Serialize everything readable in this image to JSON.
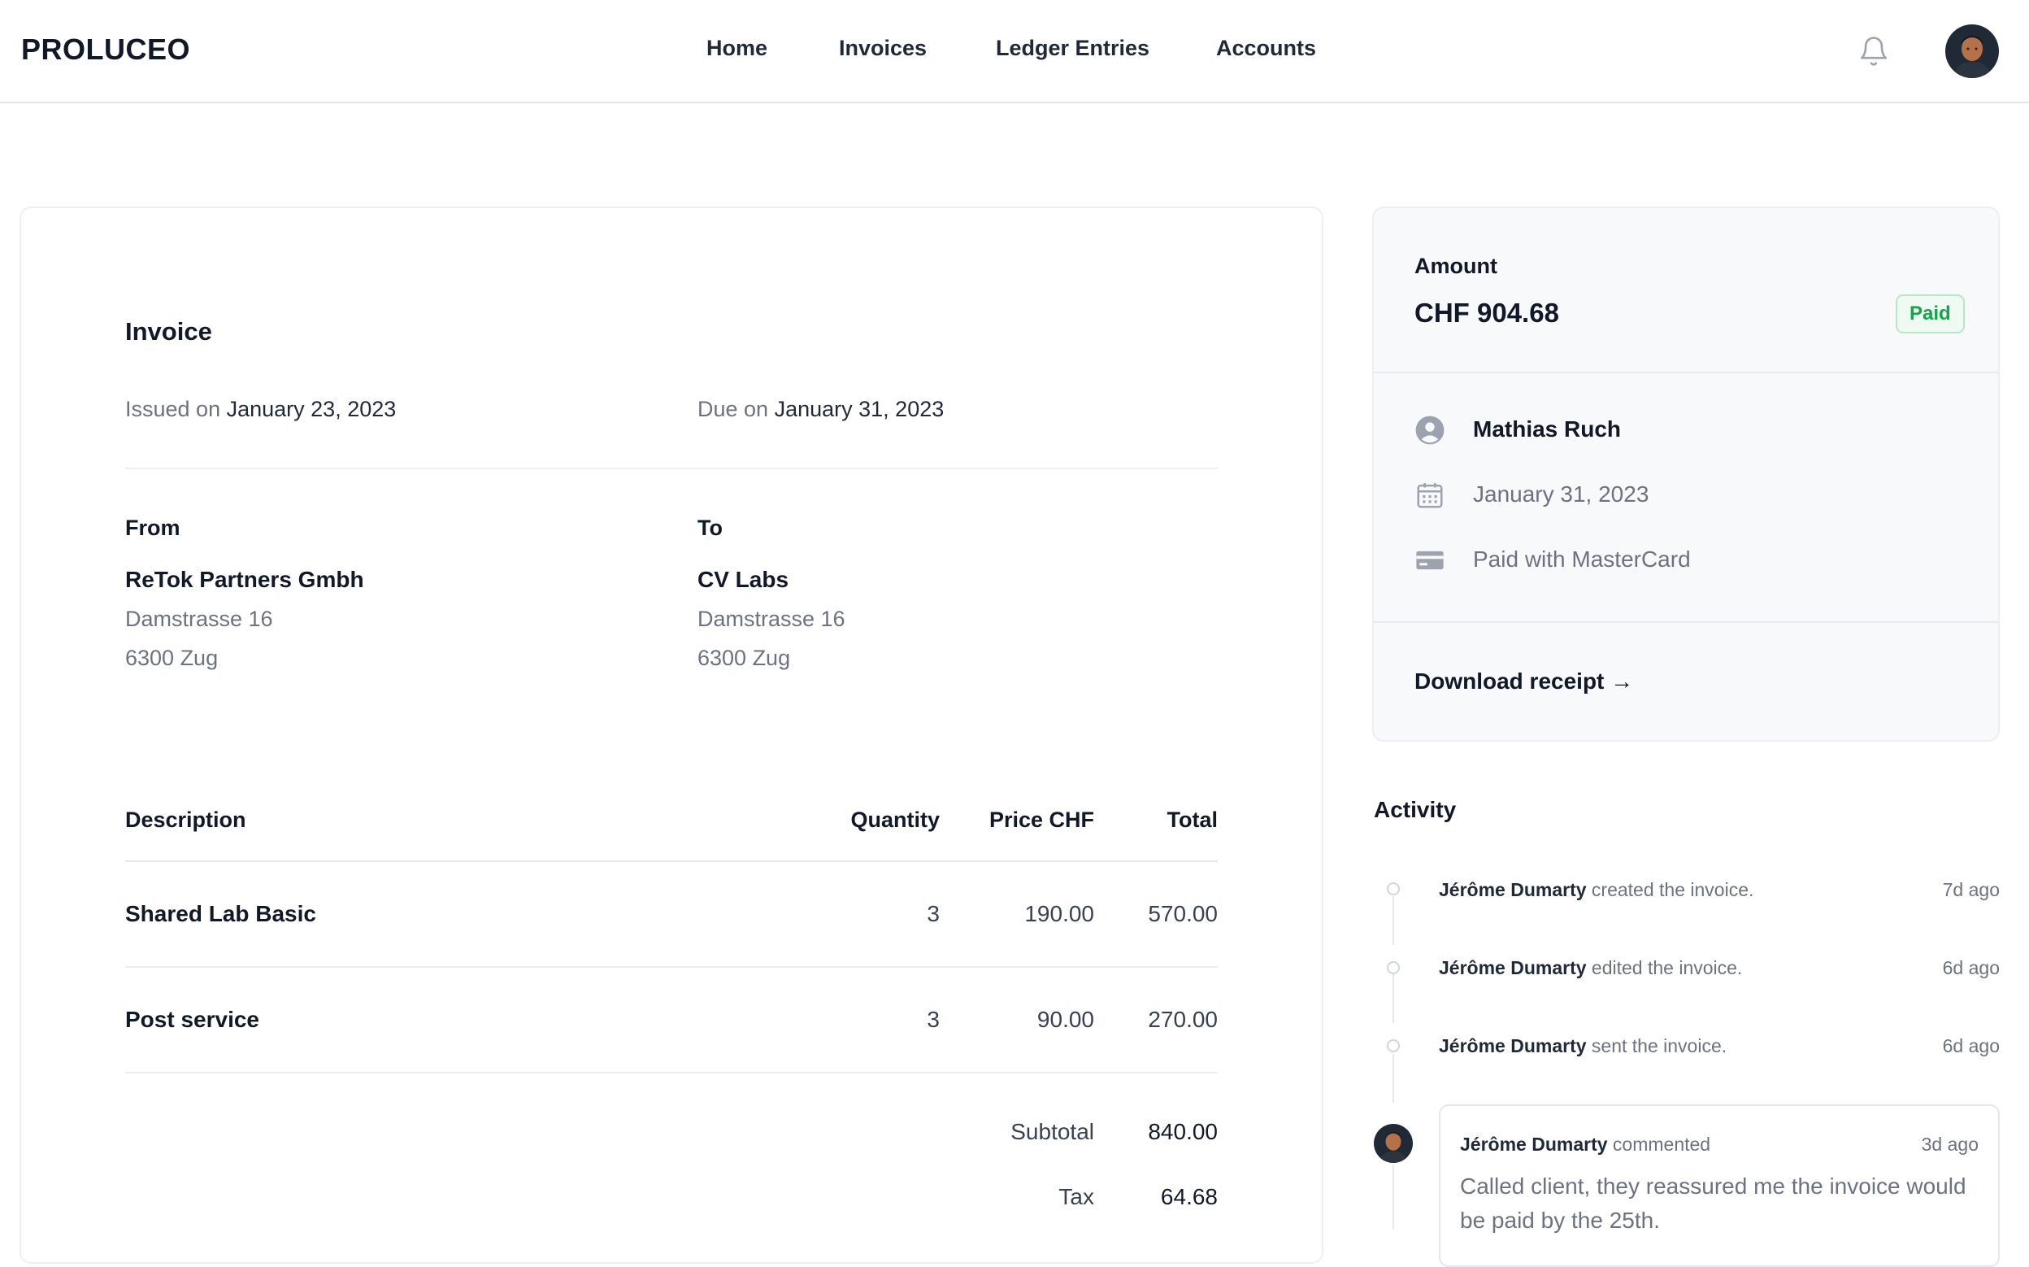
{
  "header": {
    "brand": "PROLUCEO",
    "nav": [
      "Home",
      "Invoices",
      "Ledger Entries",
      "Accounts"
    ],
    "notifications_icon": "bell-icon",
    "avatar_icon": "user-avatar"
  },
  "invoice": {
    "title": "Invoice",
    "issued_label": "Issued on",
    "issued_date": "January 23, 2023",
    "due_label": "Due on",
    "due_date": "January 31, 2023",
    "from": {
      "label": "From",
      "name": "ReTok Partners Gmbh",
      "street": "Damstrasse 16",
      "city": "6300 Zug"
    },
    "to": {
      "label": "To",
      "name": "CV Labs",
      "street": "Damstrasse 16",
      "city": "6300 Zug"
    },
    "table": {
      "headers": [
        "Description",
        "Quantity",
        "Price CHF",
        "Total"
      ],
      "rows": [
        {
          "description": "Shared Lab Basic",
          "quantity": "3",
          "price": "190.00",
          "total": "570.00"
        },
        {
          "description": "Post service",
          "quantity": "3",
          "price": "90.00",
          "total": "270.00"
        }
      ],
      "subtotal_label": "Subtotal",
      "subtotal": "840.00",
      "tax_label": "Tax",
      "tax": "64.68"
    }
  },
  "summary": {
    "amount_label": "Amount",
    "amount": "CHF 904.68",
    "status": "Paid",
    "status_color": "#16a34a",
    "client": "Mathias Ruch",
    "due_date": "January 31, 2023",
    "payment": "Paid with MasterCard",
    "download": "Download receipt →",
    "icons": [
      "user-circle-icon",
      "calendar-icon",
      "credit-card-icon"
    ]
  },
  "activity": {
    "title": "Activity",
    "items": [
      {
        "person": "Jérôme Dumarty",
        "action": "created the invoice.",
        "time": "7d ago"
      },
      {
        "person": "Jérôme Dumarty",
        "action": "edited the invoice.",
        "time": "6d ago"
      },
      {
        "person": "Jérôme Dumarty",
        "action": "sent the invoice.",
        "time": "6d ago"
      }
    ],
    "comment": {
      "person": "Jérôme Dumarty",
      "action": "commented",
      "time": "3d ago",
      "text": "Called client, they reassured me the invoice would be paid by the 25th."
    }
  }
}
